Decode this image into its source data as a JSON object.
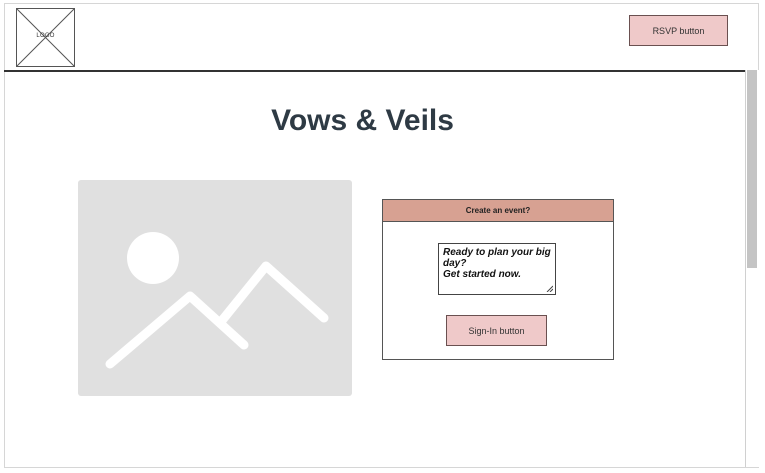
{
  "header": {
    "logo_text": "LOGO",
    "rsvp_label": "RSVP button"
  },
  "main": {
    "title": "Vows & Veils",
    "hero_icon": "image-placeholder-icon"
  },
  "event_card": {
    "header": "Create an event?",
    "textbox_lines": [
      "Ready to plan your big",
      "day?",
      "Get started now."
    ],
    "signin_label": "Sign-In button"
  },
  "colors": {
    "button_fill": "#efc9c9",
    "card_header_fill": "#d7a192",
    "title_color": "#2e3a44",
    "placeholder_gray": "#e0e0e0"
  }
}
